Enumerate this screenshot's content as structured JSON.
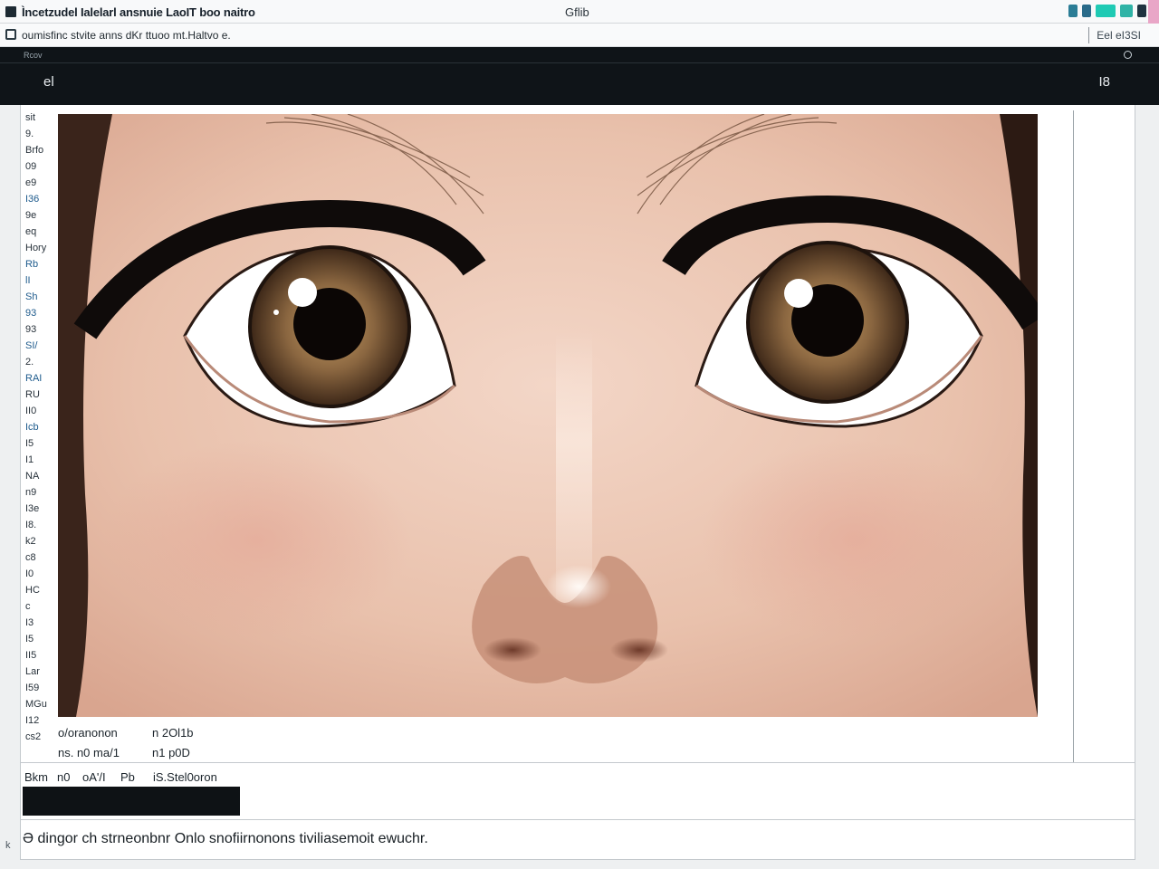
{
  "window": {
    "title": "Ìncetzudel Ialelarl ansnuie LaoIT boo naitro",
    "center_title": "Gflib"
  },
  "pathbar": {
    "path": "oumisfinc stvite anns dKr ttuoo mt.Haltvo e.",
    "right_label": "Eel eI3SI"
  },
  "toolbar": {
    "small_label": "Rcov",
    "left_label": "el",
    "right_label": "I8"
  },
  "ruler": [
    {
      "t": "sit",
      "blue": false
    },
    {
      "t": "9.",
      "blue": false
    },
    {
      "t": "Brfo",
      "blue": false
    },
    {
      "t": "09",
      "blue": false
    },
    {
      "t": "e9",
      "blue": false
    },
    {
      "t": "I36",
      "blue": true
    },
    {
      "t": "9e",
      "blue": false
    },
    {
      "t": "eq",
      "blue": false
    },
    {
      "t": "Hory",
      "blue": false
    },
    {
      "t": "Rb",
      "blue": true
    },
    {
      "t": "lI",
      "blue": true
    },
    {
      "t": "Sh",
      "blue": true
    },
    {
      "t": "93",
      "blue": true
    },
    {
      "t": "93",
      "blue": false
    },
    {
      "t": "SI/",
      "blue": true
    },
    {
      "t": "2.",
      "blue": false
    },
    {
      "t": "RAI",
      "blue": true
    },
    {
      "t": "RU",
      "blue": false
    },
    {
      "t": "II0",
      "blue": false
    },
    {
      "t": "Icb",
      "blue": true
    },
    {
      "t": "I5",
      "blue": false
    },
    {
      "t": "I1",
      "blue": false
    },
    {
      "t": "NA",
      "blue": false
    },
    {
      "t": "n9",
      "blue": false
    },
    {
      "t": "I3e",
      "blue": false
    },
    {
      "t": "I8.",
      "blue": false
    },
    {
      "t": "k2",
      "blue": false
    },
    {
      "t": "c8",
      "blue": false
    },
    {
      "t": "I0",
      "blue": false
    },
    {
      "t": "HC",
      "blue": false
    },
    {
      "t": "c",
      "blue": false
    },
    {
      "t": "I3",
      "blue": false
    },
    {
      "t": "I5",
      "blue": false
    },
    {
      "t": "II5",
      "blue": false
    },
    {
      "t": "Lar",
      "blue": false
    },
    {
      "t": "I59",
      "blue": false
    },
    {
      "t": "MGu",
      "blue": false
    },
    {
      "t": "I12",
      "blue": false
    },
    {
      "t": "cs2",
      "blue": false
    }
  ],
  "info": {
    "row1_a": "o/oranonon",
    "row1_b": "n 2Ol1b",
    "row2_a": "ns. n0   ma/1",
    "row2_b": "n1 p0D"
  },
  "lower": {
    "col1": "Bkm",
    "col2": "n0",
    "col3": "oA'/I",
    "col4": "Pb",
    "col5": "iS.Stel0oron"
  },
  "status": {
    "text": "Ә dingor ch strneonbnr Onlo snofiirnonons tiviliasemoit ewuchr."
  },
  "side_glyph": "k",
  "image": {
    "subject": "face close-up illustration",
    "skin": "#e8bfa9",
    "iris": "#7a5a3c",
    "pupil": "#0b0605",
    "lash": "#0f0b0a"
  }
}
